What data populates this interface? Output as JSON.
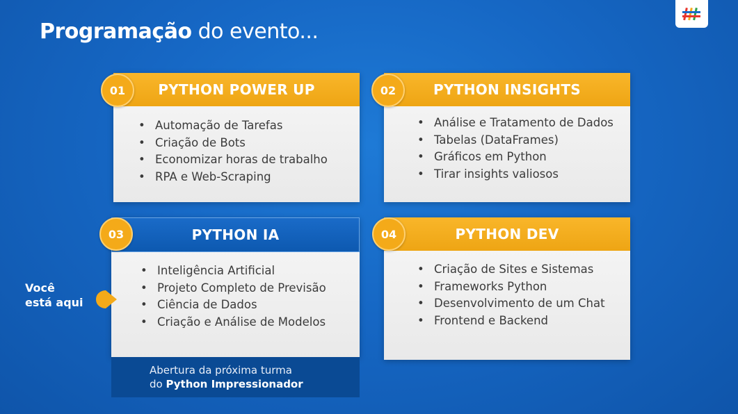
{
  "title": {
    "bold": "Programação",
    "light": "do evento..."
  },
  "cards": [
    {
      "number": "01",
      "heading": "PYTHON POWER UP",
      "items": [
        "Automação de Tarefas",
        "Criação de Bots",
        "Economizar horas de trabalho",
        "RPA e Web-Scraping"
      ]
    },
    {
      "number": "02",
      "heading": "PYTHON INSIGHTS",
      "items": [
        "Análise e Tratamento de Dados",
        "Tabelas (DataFrames)",
        "Gráficos em Python",
        "Tirar insights valiosos"
      ]
    },
    {
      "number": "03",
      "heading": "PYTHON IA",
      "items": [
        "Inteligência Artificial",
        "Projeto Completo de Previsão",
        "Ciência de Dados",
        "Criação e Análise de Modelos"
      ]
    },
    {
      "number": "04",
      "heading": "PYTHON DEV",
      "items": [
        "Criação de Sites e Sistemas",
        "Frameworks Python",
        "Desenvolvimento de um Chat",
        "Frontend e Backend"
      ]
    }
  ],
  "footer": {
    "line1": "Abertura da próxima turma",
    "line2_prefix": "do ",
    "line2_bold": "Python Impressionador"
  },
  "you_are_here": {
    "line1": "Você",
    "line2": "está aqui"
  },
  "logo": {
    "icon": "hashtag-logo-icon",
    "colors": [
      "#e8352c",
      "#f4aa19",
      "#2e9f46",
      "#1a6bc8"
    ]
  },
  "colors": {
    "orange": "#f4aa19",
    "blue": "#0d59b0",
    "background": "#1667c4"
  }
}
